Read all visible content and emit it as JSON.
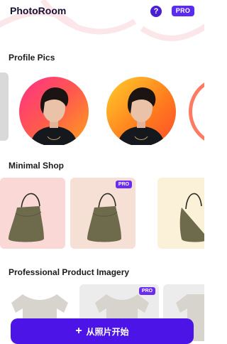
{
  "header": {
    "app_title": "PhotoRoom",
    "help_glyph": "?",
    "pro_label": "PRO"
  },
  "sections": [
    {
      "title": "Profile Pics"
    },
    {
      "title": "Minimal Shop",
      "pro_badge": "PRO"
    },
    {
      "title": "Professional Product Imagery",
      "pro_badge": "PRO"
    }
  ],
  "cta": {
    "label": "从照片开始",
    "icon": "plus-icon"
  },
  "colors": {
    "brand": "#4c14e6",
    "pro_badge": "#6a2cf0",
    "title_text": "#1a1033"
  }
}
